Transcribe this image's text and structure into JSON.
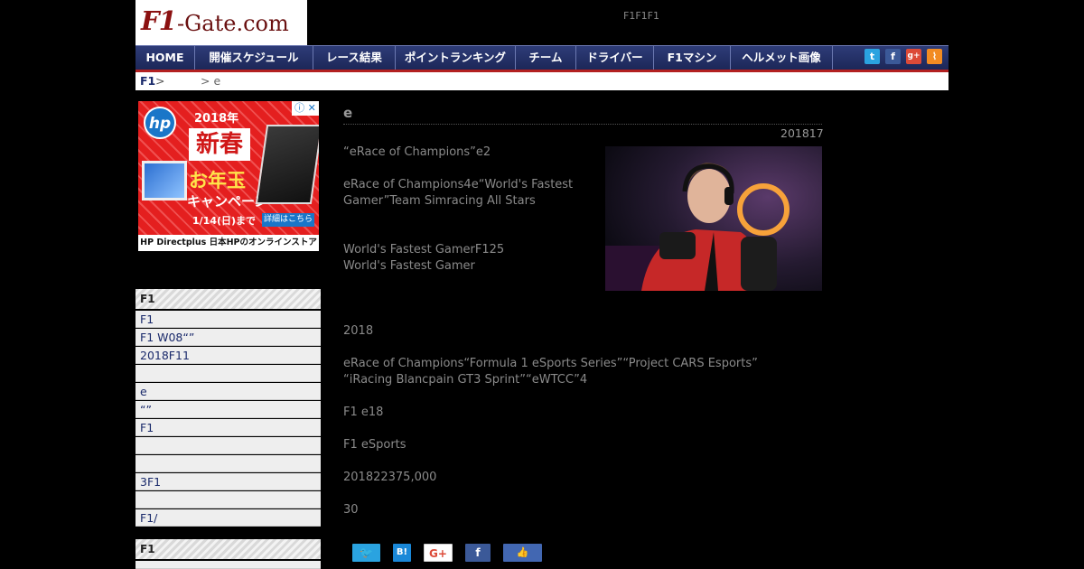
{
  "header": {
    "logo_part1": "F1",
    "logo_part2": "-Gate.com",
    "tagline": "F1F1F1"
  },
  "nav": {
    "items": [
      "HOME",
      "開催スケジュール",
      "レース結果",
      "ポイントランキング",
      "チーム",
      "ドライバー",
      "F1マシン",
      "ヘルメット画像"
    ],
    "social": [
      "twitter-icon",
      "facebook-icon",
      "google-plus-icon",
      "rss-icon"
    ],
    "social_glyphs": [
      "t",
      "f",
      "g+",
      "⌇"
    ]
  },
  "breadcrumb": {
    "home": "F1",
    "sep1": " >",
    "current": "> e"
  },
  "ad": {
    "brand": "hp",
    "year": "2018年",
    "line1": "新春",
    "line2": "お年玉",
    "line3": "キャンペーン",
    "until": "1/14(日)まで",
    "detail_btn": "詳細はこちら",
    "footer": "HP Directplus  日本HPのオンラインストア",
    "info": "ⓘ",
    "close": "✕"
  },
  "sidebar": {
    "section1_title": "F1",
    "section1_items": [
      " F1",
      "F1 W08“”",
      " 2018F11",
      "",
      "e",
      " “”",
      "F1",
      "",
      " ",
      "3F1",
      "",
      "F1/"
    ],
    "section2_title": "F1"
  },
  "article": {
    "title": "e",
    "date": "201817",
    "paragraphs": [
      "“eRace of Champions”e2",
      "eRace of Champions4e“World's Fastest",
      "Gamer”Team Simracing All Stars",
      "World's Fastest GamerF125",
      "World's Fastest Gamer",
      "2018",
      "eRace of Champions“Formula 1 eSports Series”“Project CARS Esports”",
      "“iRacing Blancpain GT3 Sprint”“eWTCC”4",
      "F1 e18",
      "F1 eSports",
      "201822375,000",
      "30"
    ]
  },
  "share": {
    "twitter": "🐦",
    "hatena": "B!",
    "gplus": "G+",
    "facebook": "f",
    "like": "👍"
  }
}
